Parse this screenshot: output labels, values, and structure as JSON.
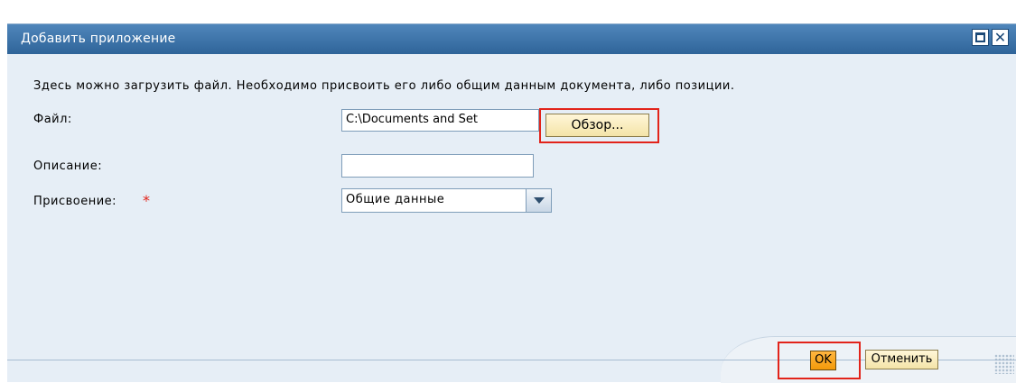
{
  "window": {
    "title": "Добавить приложение",
    "maximize_icon": "maximize-icon",
    "close_icon": "close-icon",
    "close_glyph": "✕"
  },
  "form": {
    "instruction": "Здесь можно загрузить файл. Необходимо присвоить его либо общим данным документа, либо позиции.",
    "file_label": "Файл:",
    "file_value": "C:\\Documents and Set",
    "browse_label": "Обзор...",
    "description_label": "Описание:",
    "description_value": "",
    "assignment_label": "Присвоение:",
    "required_marker": "*",
    "assignment_value": "Общие данные"
  },
  "footer": {
    "ok_label": "OK",
    "cancel_label": "Отменить"
  },
  "colors": {
    "titlebar": "#3a72a8",
    "background": "#e6eef6",
    "highlight": "#e2231a",
    "ok_button": "#f7a823"
  }
}
